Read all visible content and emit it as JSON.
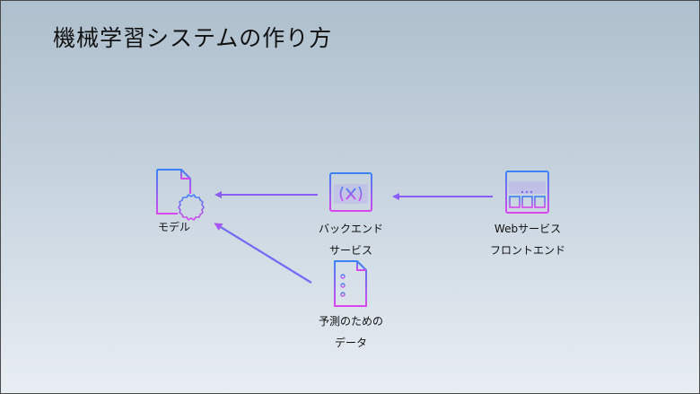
{
  "slide": {
    "title": "機械学習システムの作り方"
  },
  "nodes": {
    "model": {
      "label": "モデル",
      "icon": "model-document-icon"
    },
    "backend": {
      "line1": "バックエンド",
      "line2": "サービス",
      "icon": "backend-service-window-icon"
    },
    "frontend": {
      "line1": "Webサービス",
      "line2": "フロントエンド",
      "icon": "frontend-web-window-icon"
    },
    "data": {
      "line1": "予測のための",
      "line2": "データ",
      "icon": "data-document-icon"
    }
  },
  "colors": {
    "icon_gradient_top": "#3b82f6",
    "icon_gradient_bottom": "#d946ef",
    "arrow": "#8b5cf6"
  }
}
